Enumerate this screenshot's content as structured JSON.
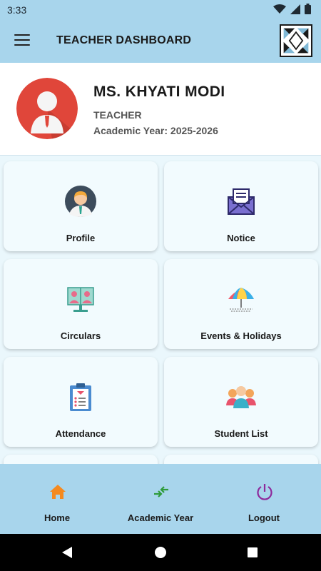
{
  "status_bar": {
    "time": "3:33"
  },
  "app_bar": {
    "title": "TEACHER DASHBOARD"
  },
  "profile": {
    "name": "MS. KHYATI MODI",
    "role": "TEACHER",
    "academic_year": "Academic Year: 2025-2026"
  },
  "menu": [
    {
      "label": "Profile",
      "icon": "teacher-avatar-icon"
    },
    {
      "label": "Notice",
      "icon": "envelope-icon"
    },
    {
      "label": "Circulars",
      "icon": "monitor-people-icon"
    },
    {
      "label": "Events & Holidays",
      "icon": "umbrella-icon"
    },
    {
      "label": "Attendance",
      "icon": "clipboard-icon"
    },
    {
      "label": "Student List",
      "icon": "group-people-icon"
    }
  ],
  "bottom_nav": [
    {
      "label": "Home",
      "icon": "home-icon",
      "color": "#f58a1f"
    },
    {
      "label": "Academic Year",
      "icon": "swap-arrows-icon",
      "color": "#2e9b3a"
    },
    {
      "label": "Logout",
      "icon": "power-icon",
      "color": "#8e2a9c"
    }
  ],
  "colors": {
    "bar": "#a8d5ec",
    "card": "#f2fbfe",
    "background": "#eaf7fc"
  }
}
